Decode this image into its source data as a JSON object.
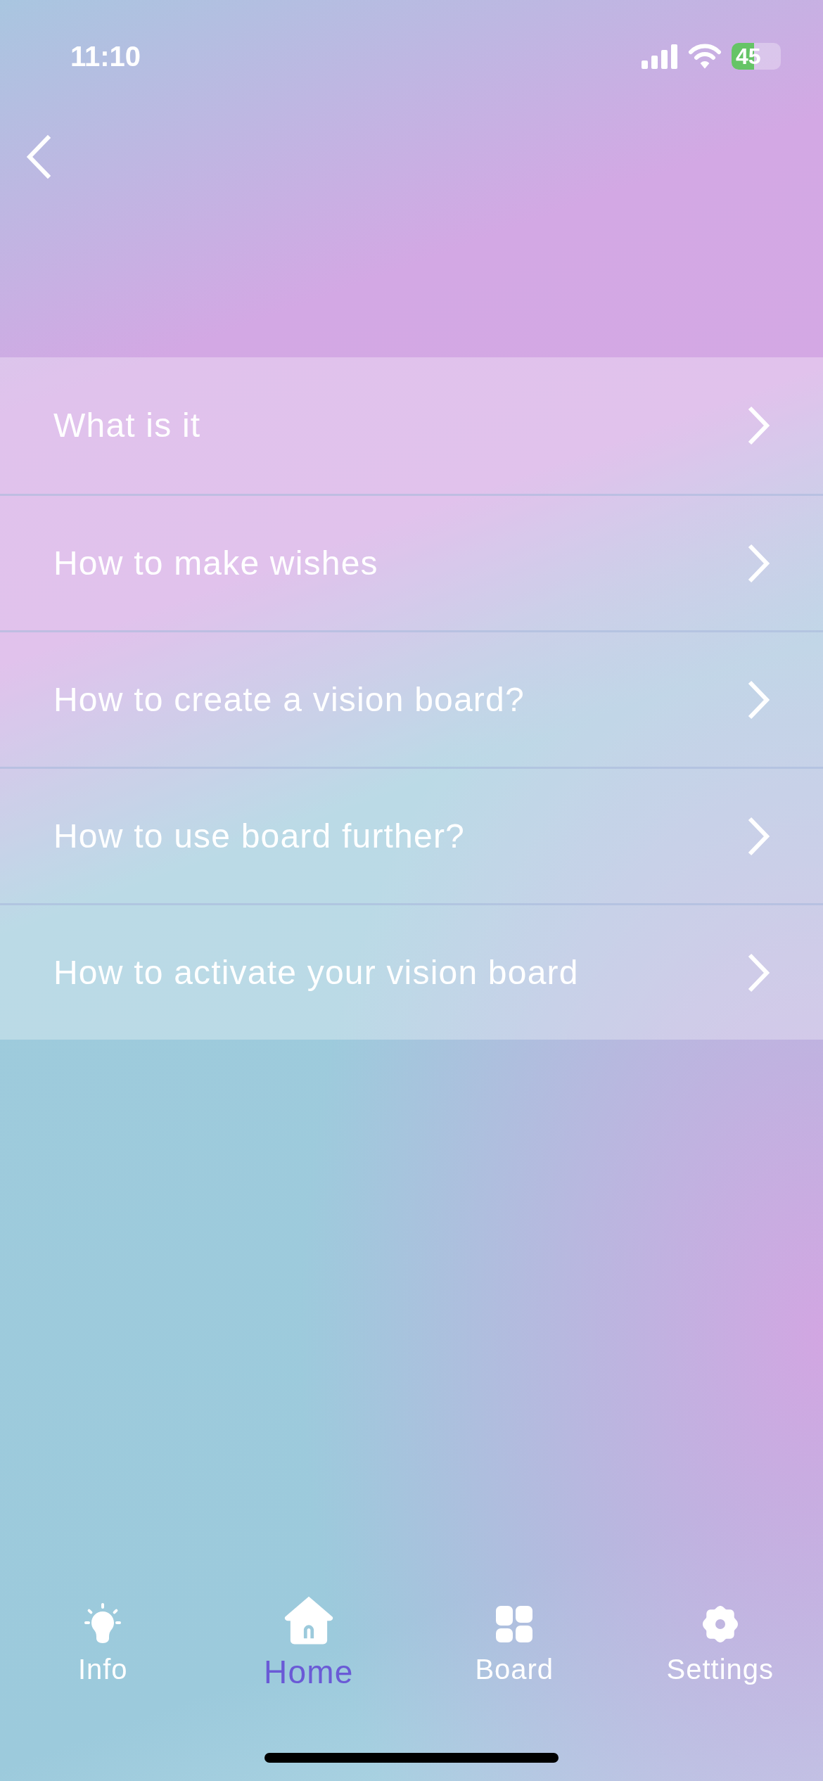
{
  "status_bar": {
    "time": "11:10",
    "battery": "45"
  },
  "faq_items": [
    {
      "label": "What is it"
    },
    {
      "label": "How to make wishes"
    },
    {
      "label": "How to create a vision board?"
    },
    {
      "label": "How to use board further?"
    },
    {
      "label": "How to activate your vision board"
    }
  ],
  "tab_bar": [
    {
      "kind": "info",
      "label": "Info",
      "selected": false
    },
    {
      "kind": "home",
      "label": "Home",
      "selected": true
    },
    {
      "kind": "board",
      "label": "Board",
      "selected": false
    },
    {
      "kind": "settings",
      "label": "Settings",
      "selected": false
    }
  ]
}
